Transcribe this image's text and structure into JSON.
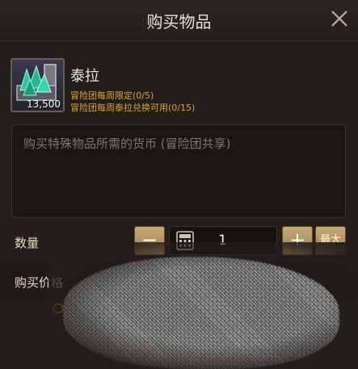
{
  "dialog": {
    "title": "购买物品",
    "close_icon": "close-icon"
  },
  "item": {
    "name": "泰拉",
    "icon": "tera-crystal-icon",
    "quantity": "13,500",
    "weekly_limit": "冒险团每周限定(0/5)",
    "weekly_exchange": "冒险团每周泰拉兑换可用(0/15)"
  },
  "currency_box": {
    "text": "购买特殊物品所需的货币 (冒险团共享)"
  },
  "quantity_row": {
    "label": "数量",
    "minus": "−",
    "value": "1",
    "plus": "+",
    "max": "最大",
    "calculator_icon": "calculator-icon"
  },
  "price_row": {
    "label": "购买价格"
  },
  "colors": {
    "accent_gold": "#e3a428",
    "button_tan": "#b8996a",
    "background": "#231e1a"
  }
}
